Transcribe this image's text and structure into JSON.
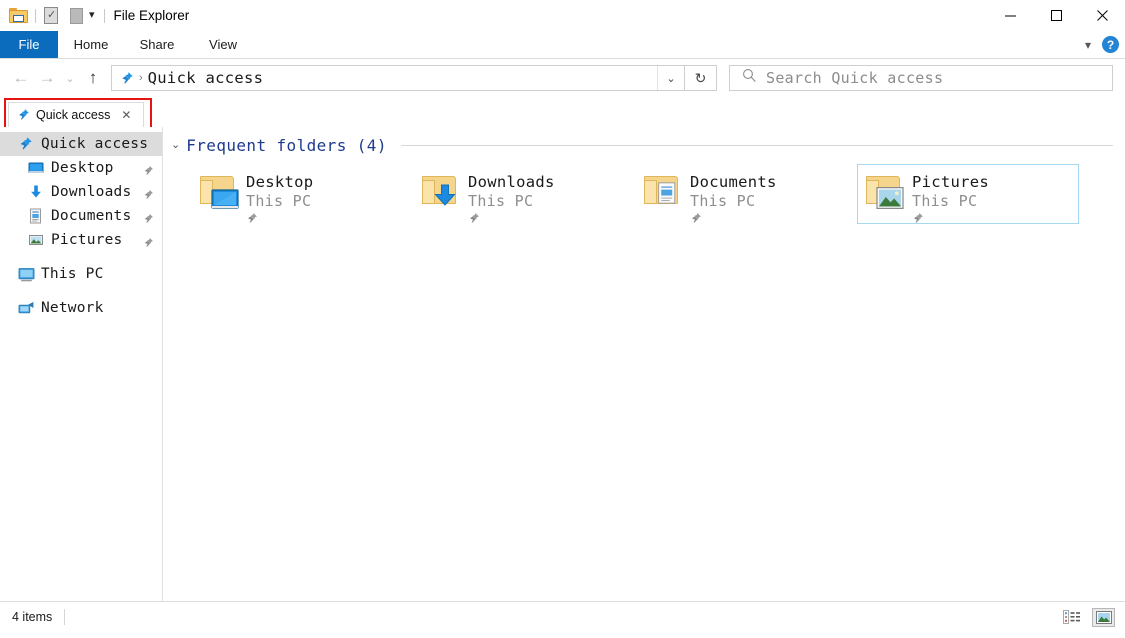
{
  "window": {
    "title": "File Explorer",
    "quick_access_toolbar": [
      {
        "name": "folder-icon",
        "label": "File Explorer"
      },
      {
        "name": "properties-icon",
        "label": "Properties"
      },
      {
        "name": "new-folder-icon",
        "label": "New folder"
      },
      {
        "name": "customize-chevron-icon",
        "label": "Customize Quick Access Toolbar"
      }
    ],
    "controls": {
      "minimize": "—",
      "maximize": "☐",
      "close": "✕"
    }
  },
  "ribbon": {
    "tabs": [
      {
        "id": "file",
        "label": "File",
        "active": true
      },
      {
        "id": "home",
        "label": "Home",
        "active": false
      },
      {
        "id": "share",
        "label": "Share",
        "active": false
      },
      {
        "id": "view",
        "label": "View",
        "active": false
      }
    ],
    "expand_label": "⌄",
    "help_label": "?"
  },
  "navigation": {
    "back": "←",
    "forward": "→",
    "recent": "⌄",
    "up": "↑",
    "address": {
      "crumb_icon": "pin-icon",
      "separator": "›",
      "path": "Quick access",
      "dropdown": "⌄"
    },
    "refresh": "↻",
    "search": {
      "icon": "search-icon",
      "placeholder": "Search Quick access",
      "value": ""
    }
  },
  "tabstrip": {
    "tabs": [
      {
        "label": "Quick access",
        "icon": "pin-icon",
        "close": "✕",
        "active": true
      }
    ]
  },
  "sidebar": {
    "items": [
      {
        "label": "Quick access",
        "icon": "pin-icon",
        "selected": true,
        "indent": "root",
        "pinned": false
      },
      {
        "label": "Desktop",
        "icon": "desktop-icon",
        "selected": false,
        "indent": "child",
        "pinned": true
      },
      {
        "label": "Downloads",
        "icon": "downloads-icon",
        "selected": false,
        "indent": "child",
        "pinned": true
      },
      {
        "label": "Documents",
        "icon": "documents-icon",
        "selected": false,
        "indent": "child",
        "pinned": true
      },
      {
        "label": "Pictures",
        "icon": "pictures-icon",
        "selected": false,
        "indent": "child",
        "pinned": true
      },
      {
        "label": "This PC",
        "icon": "this-pc-icon",
        "selected": false,
        "indent": "root",
        "pinned": false
      },
      {
        "label": "Network",
        "icon": "network-icon",
        "selected": false,
        "indent": "root",
        "pinned": false
      }
    ]
  },
  "content": {
    "group": {
      "chevron": "⌄",
      "title": "Frequent folders (4)"
    },
    "tiles": [
      {
        "title": "Desktop",
        "subtitle": "This PC",
        "icon": "folder-desktop-icon",
        "pinned": true,
        "selected": false
      },
      {
        "title": "Downloads",
        "subtitle": "This PC",
        "icon": "folder-downloads-icon",
        "pinned": true,
        "selected": false
      },
      {
        "title": "Documents",
        "subtitle": "This PC",
        "icon": "folder-documents-icon",
        "pinned": true,
        "selected": false
      },
      {
        "title": "Pictures",
        "subtitle": "This PC",
        "icon": "folder-pictures-icon",
        "pinned": true,
        "selected": true
      }
    ]
  },
  "statusbar": {
    "items_text": "4 items",
    "views": [
      {
        "name": "details-view-button",
        "active": false
      },
      {
        "name": "large-icons-view-button",
        "active": true
      }
    ]
  },
  "annotation": {
    "color": "#e81313",
    "target": "quick-access-tab"
  },
  "colors": {
    "accent": "#0b6cbd",
    "group_title": "#1e3a8f",
    "selection_border": "#a6d9f2",
    "sidebar_selected": "#dcdcdc",
    "annotation_red": "#e81313"
  }
}
